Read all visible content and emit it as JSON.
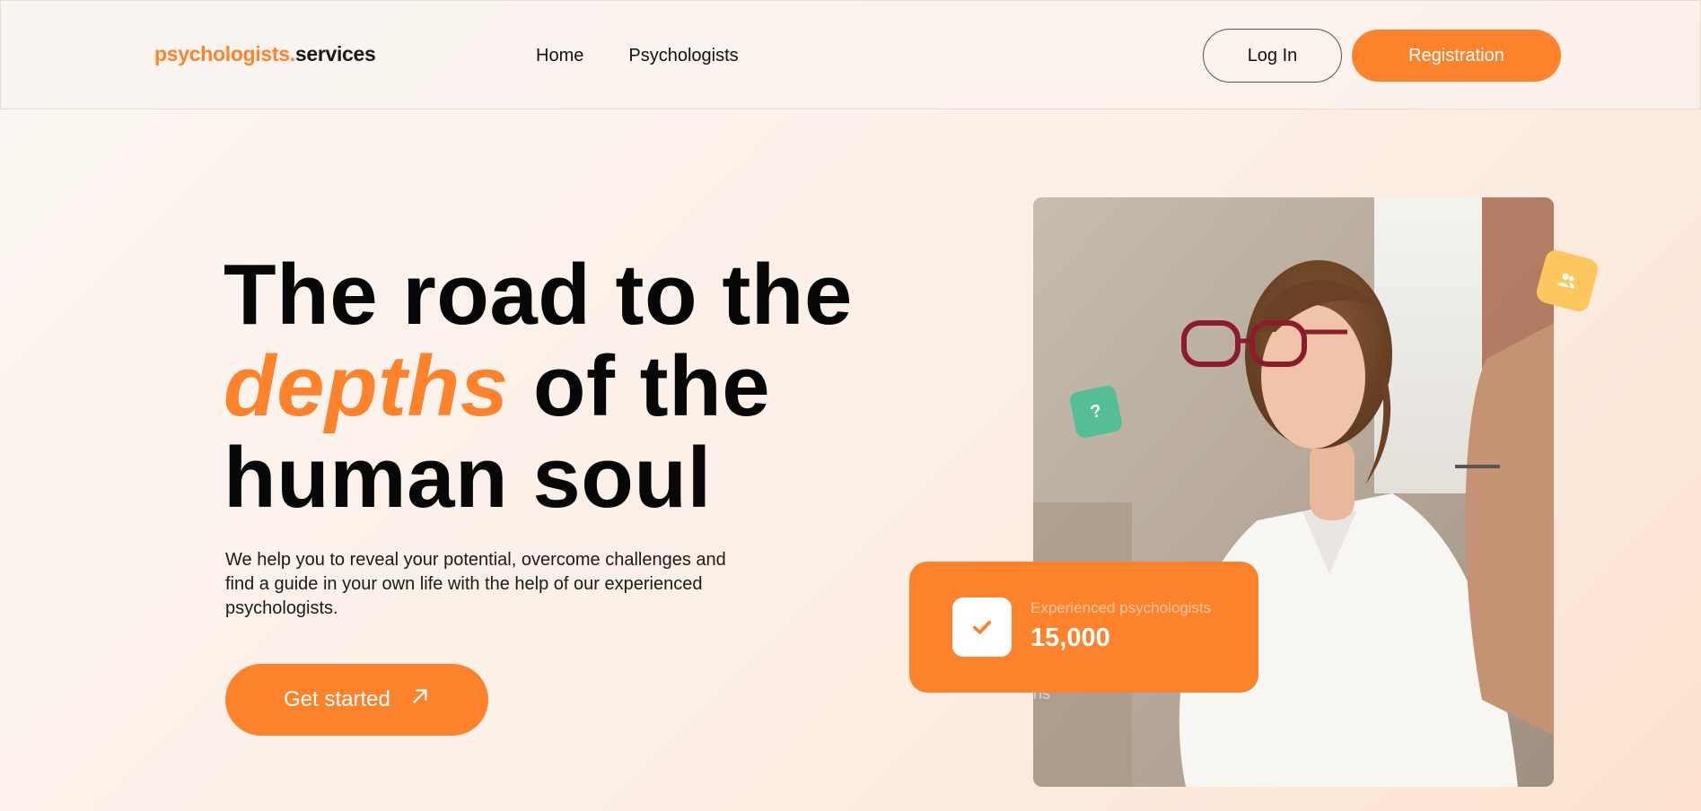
{
  "header": {
    "logo_accent": "psychologists.",
    "logo_rest": "services",
    "nav": [
      {
        "label": "Home"
      },
      {
        "label": "Psychologists"
      }
    ],
    "login_label": "Log In",
    "register_label": "Registration"
  },
  "hero": {
    "title_line1": "The road to the",
    "title_accent": "depths",
    "title_line2_rest": " of the",
    "title_line3": "human soul",
    "subtitle": "We help you to reveal your potential, overcome challenges and find a guide in your own life with the help of our experienced psychologists.",
    "cta_label": "Get started"
  },
  "visual": {
    "question_badge": "?",
    "stat_label": "Experienced psychologists",
    "stat_value": "15,000"
  },
  "colors": {
    "accent": "#fc832c",
    "badge_yellow": "#fbc75e",
    "badge_green": "#54be96"
  },
  "icons": [
    "users-icon",
    "question-icon",
    "check-icon",
    "arrow-up-right-icon"
  ]
}
